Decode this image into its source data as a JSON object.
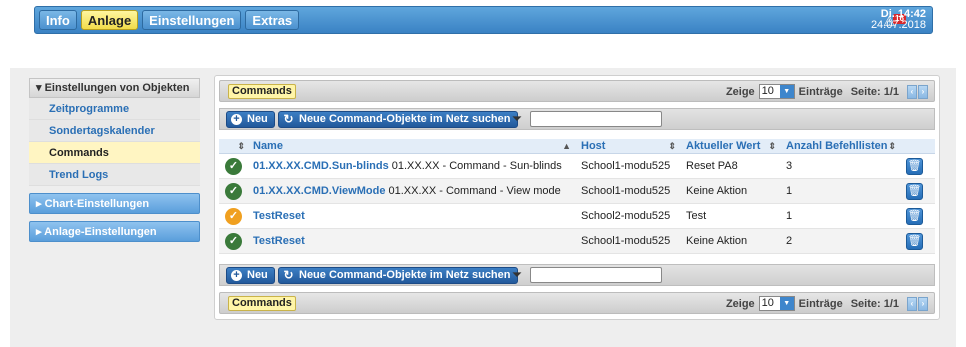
{
  "nav": {
    "tabs": [
      {
        "label": "Info",
        "active": false
      },
      {
        "label": "Anlage",
        "active": true
      },
      {
        "label": "Einstellungen",
        "active": false
      },
      {
        "label": "Extras",
        "active": false
      }
    ]
  },
  "alarm": {
    "count": "16",
    "icon": "alarm-bell-icon"
  },
  "clock": {
    "time": "Di. 14:42",
    "date": "24.07.2018"
  },
  "sidebar": {
    "section_title": "Einstellungen von Objekten",
    "items": [
      {
        "label": "Zeitprogramme",
        "active": false
      },
      {
        "label": "Sondertagskalender",
        "active": false
      },
      {
        "label": "Commands",
        "active": true
      },
      {
        "label": "Trend Logs",
        "active": false
      }
    ],
    "groups": [
      {
        "label": "Chart-Einstellungen"
      },
      {
        "label": "Anlage-Einstellungen"
      }
    ]
  },
  "pager": {
    "title": "Commands",
    "show_label": "Zeige",
    "per_page": "10",
    "entries_label": "Einträge",
    "page_label": "Seite: 1/1"
  },
  "toolbar": {
    "new_label": "Neu",
    "search_label": "Neue Command-Objekte im Netz suchen",
    "filter_value": ""
  },
  "table": {
    "columns": [
      "Name",
      "Host",
      "Aktueller Wert",
      "Anzahl Befehllisten"
    ],
    "rows": [
      {
        "status": "ok",
        "name": "01.XX.XX.CMD.Sun-blinds",
        "desc": "01.XX.XX - Command - Sun-blinds",
        "host": "School1-modu525",
        "value": "Reset PA8",
        "count": "3"
      },
      {
        "status": "ok",
        "name": "01.XX.XX.CMD.ViewMode",
        "desc": "01.XX.XX - Command - View mode",
        "host": "School1-modu525",
        "value": "Keine Aktion",
        "count": "1"
      },
      {
        "status": "warn",
        "name": "TestReset",
        "desc": "",
        "host": "School2-modu525",
        "value": "Test",
        "count": "1"
      },
      {
        "status": "ok",
        "name": "TestReset",
        "desc": "",
        "host": "School1-modu525",
        "value": "Keine Aktion",
        "count": "2"
      }
    ]
  },
  "colors": {
    "accent": "#3a82c4",
    "highlight": "#fff5c2",
    "ok": "#3a7a3a",
    "warn": "#f0a020"
  }
}
